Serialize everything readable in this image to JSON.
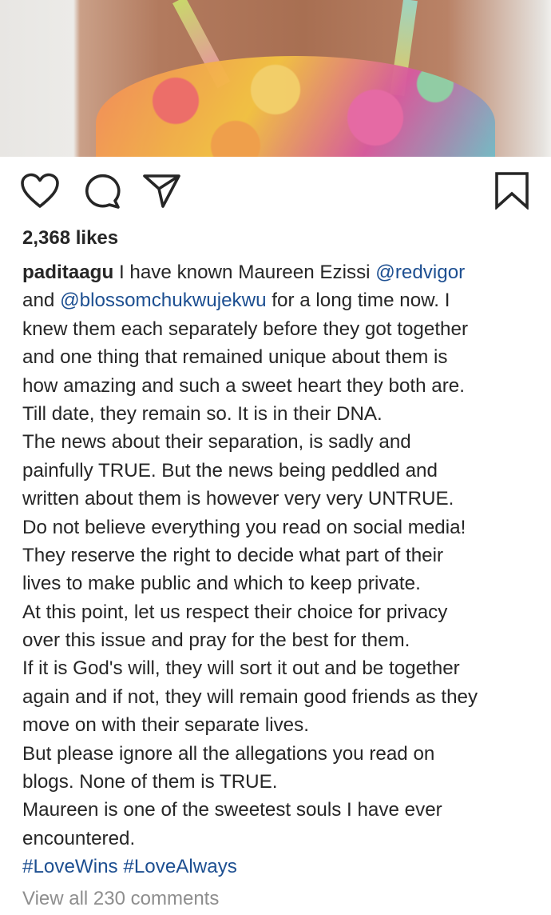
{
  "post": {
    "likes": "2,368 likes",
    "username": "paditaagu",
    "caption_lines": [
      {
        "pre": " I have known Maureen Ezissi ",
        "mention": "@redvigor",
        "post": ""
      },
      {
        "pre": "and ",
        "mention": "@blossomchukwujekwu",
        "post": " for a long time now. I"
      },
      {
        "text": "knew them each separately before they got together"
      },
      {
        "text": "and one thing that remained unique about them is"
      },
      {
        "text": "how amazing and such a sweet heart they both are."
      },
      {
        "text": "Till date, they remain so. It is in their DNA."
      },
      {
        "text": "The news about their separation, is sadly and"
      },
      {
        "text": "painfully TRUE. But the news being peddled and"
      },
      {
        "text": "written about them is however very very UNTRUE."
      },
      {
        "text": "Do not believe everything you read on social media!"
      },
      {
        "text": "They reserve the right to decide what part of their"
      },
      {
        "text": "lives to make public and which to keep private."
      },
      {
        "text": "At this point, let us respect their choice for privacy"
      },
      {
        "text": "over this issue and pray for the best for them."
      },
      {
        "text": "If it is God's will, they will sort it out and be together"
      },
      {
        "text": "again and if not, they will remain good friends as they"
      },
      {
        "text": "move on with their separate lives."
      },
      {
        "text": "But please ignore all the allegations you read on"
      },
      {
        "text": "blogs. None of them is TRUE."
      },
      {
        "text": "Maureen is one of the sweetest souls I have ever"
      },
      {
        "text": "encountered."
      }
    ],
    "hashtags": [
      "#LoveWins",
      "#LoveAlways"
    ],
    "view_comments": "View all 230 comments"
  },
  "icons": {
    "like": "heart-icon",
    "comment": "comment-bubble-icon",
    "share": "paper-plane-icon",
    "save": "bookmark-icon"
  },
  "colors": {
    "text": "#262626",
    "link": "#1d4f91",
    "muted": "#8e8e8e"
  }
}
